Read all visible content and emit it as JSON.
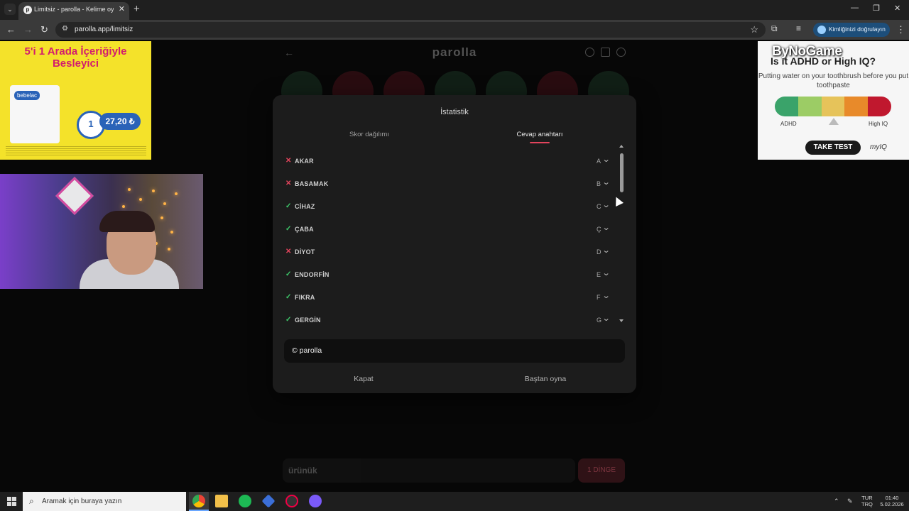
{
  "browser": {
    "tab_title": "Limitsiz - parolla - Kelime oyunu",
    "url": "parolla.app/limitsiz",
    "profile_label": "Kimliğinizi doğrulayın",
    "window_controls": [
      "—",
      "❐",
      "✕"
    ]
  },
  "ads": {
    "left": {
      "headline": "5'i 1 Arada İçeriğiyle Besleyici",
      "brand": "bebelac",
      "bowl_label": "1",
      "price": "27,20 ₺"
    },
    "right": {
      "logo": "ByNoGame",
      "title": "Is it ADHD or High IQ?",
      "subtitle": "Putting water on your toothbrush before you put toothpaste",
      "low_label": "ADHD",
      "high_label": "High IQ",
      "button": "TAKE TEST",
      "brand": "myIQ",
      "scale_colors": [
        "#3aa36a",
        "#9ccc65",
        "#e6c35a",
        "#e88a2a",
        "#c0182e"
      ]
    }
  },
  "game": {
    "logo": "parolla",
    "input_placeholder": "ürünük",
    "pass_button": "1 DİNGE",
    "bubble_colors": [
      "#2c5a3a",
      "#7a1a28",
      "#7a1a28",
      "#2c5a3a",
      "#2c5a3a",
      "#7a1a28",
      "#2c5a3a"
    ]
  },
  "modal": {
    "title": "İstatistik",
    "tabs": [
      "Skor dağılımı",
      "Cevap anahtarı"
    ],
    "active_tab": "Cevap anahtarı",
    "answers": [
      {
        "word": "AKAR",
        "letter": "A",
        "correct": false
      },
      {
        "word": "BASAMAK",
        "letter": "B",
        "correct": false
      },
      {
        "word": "CİHAZ",
        "letter": "C",
        "correct": true
      },
      {
        "word": "ÇABA",
        "letter": "Ç",
        "correct": true
      },
      {
        "word": "DİYOT",
        "letter": "D",
        "correct": false
      },
      {
        "word": "ENDORFİN",
        "letter": "E",
        "correct": true
      },
      {
        "word": "FIKRA",
        "letter": "F",
        "correct": true
      },
      {
        "word": "GERGİN",
        "letter": "G",
        "correct": true
      }
    ],
    "copyright": "© parolla",
    "close_button": "Kapat",
    "replay_button": "Baştan oyna",
    "accent_color": "#e2445c"
  },
  "taskbar": {
    "search_placeholder": "Aramak için buraya yazın",
    "lang_line1": "TUR",
    "lang_line2": "TRQ",
    "time": "01:40",
    "date": "5.02.2026"
  }
}
